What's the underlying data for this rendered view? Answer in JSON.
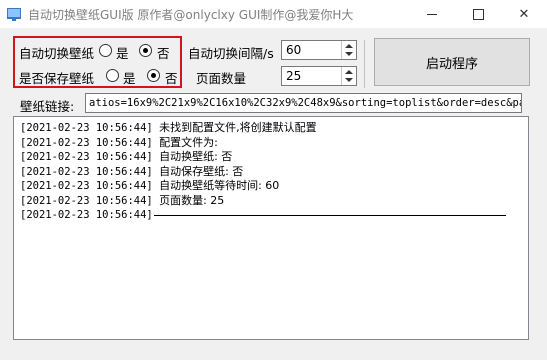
{
  "window": {
    "title": "自动切换壁纸GUI版 原作者@onlyclxy GUI制作@我爱你H大",
    "icons": [
      "app-icon",
      "minimize-icon",
      "maximize-icon",
      "close-icon"
    ]
  },
  "options": {
    "auto_switch": {
      "label": "自动切换壁纸",
      "yes": "是",
      "no": "否",
      "selected": "否"
    },
    "auto_save": {
      "label": "是否保存壁纸",
      "yes": "是",
      "no": "否",
      "selected": "否"
    },
    "interval": {
      "label": "自动切换间隔/s",
      "value": "60"
    },
    "page_count": {
      "label": "页面数量",
      "value": "25"
    }
  },
  "start_button": {
    "label": "启动程序"
  },
  "url": {
    "label": "壁纸链接:",
    "value": "atios=16x9%2C21x9%2C16x10%2C32x9%2C48x9&sorting=toplist&order=desc&page="
  },
  "log": [
    {
      "ts": "[2021-02-23 10:56:44]",
      "msg": "未找到配置文件,将创建默认配置"
    },
    {
      "ts": "[2021-02-23 10:56:44]",
      "msg": "配置文件为:"
    },
    {
      "ts": "[2021-02-23 10:56:44]",
      "msg": "自动换壁纸: 否"
    },
    {
      "ts": "[2021-02-23 10:56:44]",
      "msg": "自动保存壁纸: 否"
    },
    {
      "ts": "[2021-02-23 10:56:44]",
      "msg": "自动换壁纸等待时间: 60"
    },
    {
      "ts": "[2021-02-23 10:56:44]",
      "msg": "页面数量: 25"
    },
    {
      "ts": "[2021-02-23 10:56:44]",
      "msg": ""
    }
  ],
  "colors": {
    "highlight_border": "#d0161b",
    "window_bg": "#f0f0f0"
  }
}
